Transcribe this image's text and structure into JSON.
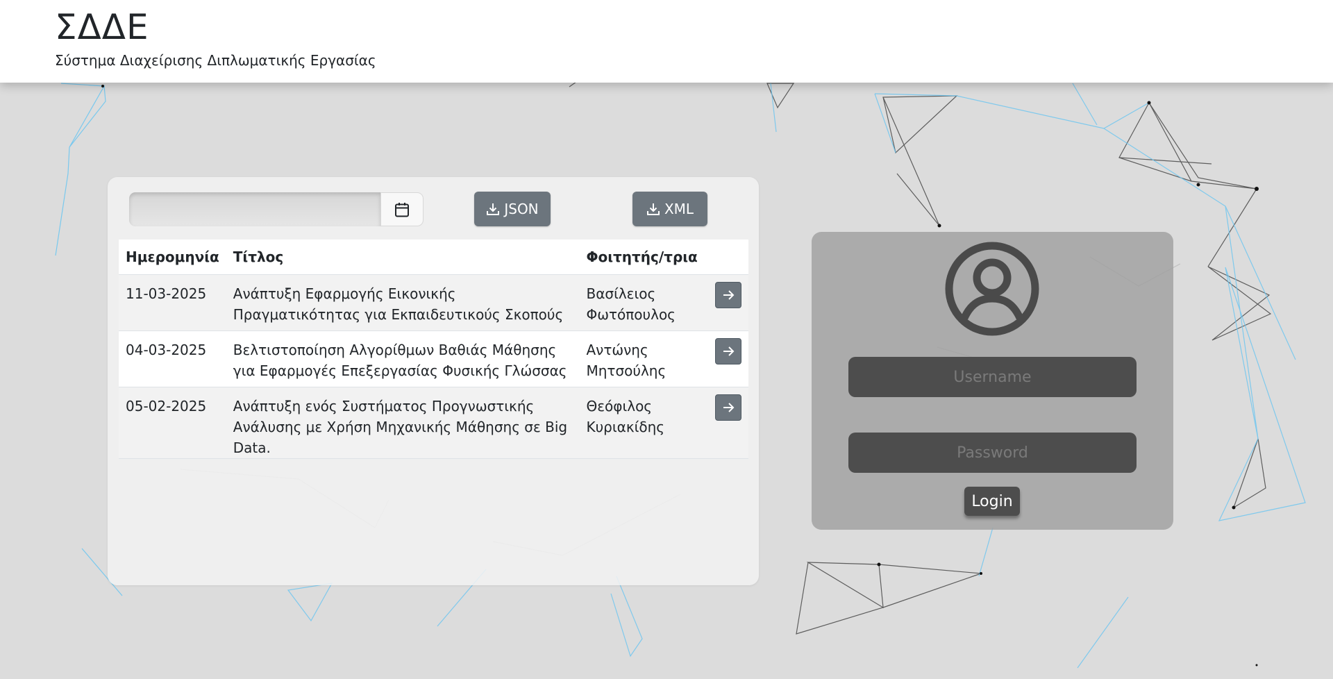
{
  "header": {
    "title": "ΣΔΔΕ",
    "subtitle": "Σύστημα Διαχείρισης Διπλωματικής Εργασίας"
  },
  "filters": {
    "date_value": "",
    "calendar_icon": "calendar-icon"
  },
  "exports": {
    "json_label": "JSON",
    "xml_label": "XML",
    "icon": "download-icon"
  },
  "table": {
    "headers": {
      "date": "Ημερομηνία",
      "title": "Τίτλος",
      "student": "Φοιτητής/τρια"
    },
    "rows": [
      {
        "date": "11-03-2025",
        "title": "Ανάπτυξη Εφαρμογής Εικονικής Πραγματικότητας για Εκπαιδευτικούς Σκοπούς",
        "student": "Βασίλειος Φωτόπουλος"
      },
      {
        "date": "04-03-2025",
        "title": "Βελτιστοποίηση Αλγορίθμων Βαθιάς Μάθησης για Εφαρμογές Επεξεργασίας Φυσικής Γλώσσας",
        "student": "Αντώνης Μητσούλης"
      },
      {
        "date": "05-02-2025",
        "title": "Ανάπτυξη ενός Συστήματος Προγνωστικής Ανάλυσης με Χρήση Μηχανικής Μάθησης σε Big Data.",
        "student": "Θεόφιλος Κυριακίδης"
      }
    ],
    "row_action_icon": "arrow-right-icon"
  },
  "login": {
    "avatar_icon": "user-circle-icon",
    "username_placeholder": "Username",
    "password_placeholder": "Password",
    "button_label": "Login"
  },
  "colors": {
    "button_gray": "#6c757d",
    "login_dark": "#4d4d4d",
    "network_blue": "#5bc0eb",
    "network_dark": "#222222"
  }
}
